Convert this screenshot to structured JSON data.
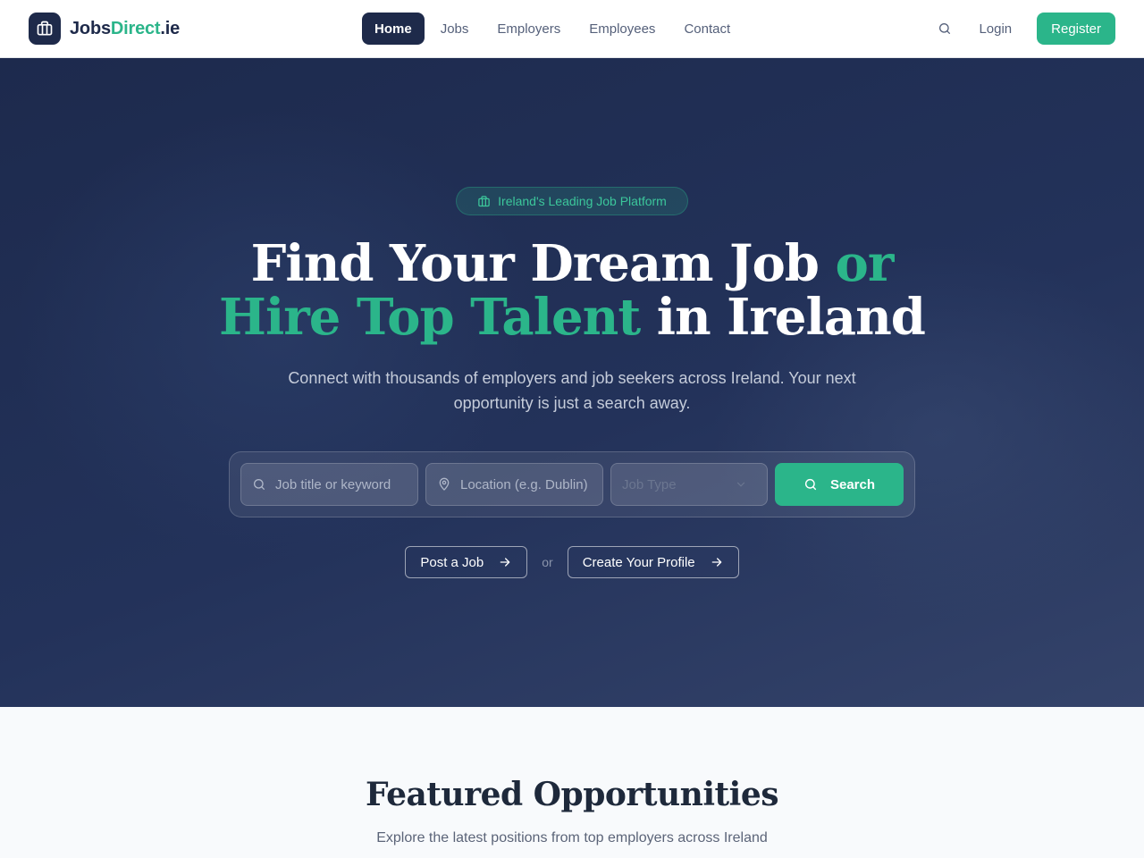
{
  "brand": {
    "name_part1": "Jobs",
    "name_part2": "Direct",
    "name_part3": ".ie",
    "accent_color": "#2bb58a",
    "dark_color": "#1e2a4a",
    "icon": "briefcase-icon"
  },
  "nav": {
    "items": [
      {
        "label": "Home",
        "active": true
      },
      {
        "label": "Jobs",
        "active": false
      },
      {
        "label": "Employers",
        "active": false
      },
      {
        "label": "Employees",
        "active": false
      },
      {
        "label": "Contact",
        "active": false
      }
    ]
  },
  "header_actions": {
    "search_icon": "search-icon",
    "login_label": "Login",
    "register_label": "Register"
  },
  "hero": {
    "badge": "Ireland's Leading Job Platform",
    "headline_line1_white": "Find Your Dream Job ",
    "headline_line1_green": "or",
    "headline_line2_green": "Hire Top Talent",
    "headline_line2_white": " in Ireland",
    "subtext": "Connect with thousands of employers and job seekers across Ireland. Your next opportunity is just a search away."
  },
  "search": {
    "keyword_placeholder": "Job title or keyword",
    "location_placeholder": "Location (e.g. Dublin)",
    "job_type_selected": "Job Type",
    "button_label": "Search"
  },
  "ctas": {
    "post_job": "Post a Job",
    "or": "or",
    "create_profile": "Create Your Profile"
  },
  "featured": {
    "title": "Featured Opportunities",
    "subtitle": "Explore the latest positions from top employers across Ireland"
  }
}
